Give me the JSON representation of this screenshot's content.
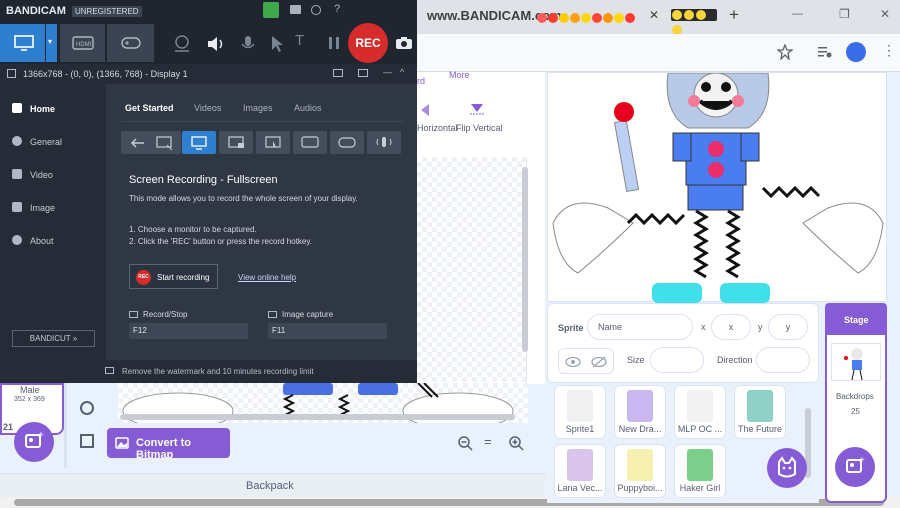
{
  "chrome": {
    "watermark": "www.BANDICAM.com",
    "tab_emojis": [
      "#ff5a5a",
      "#ff3b30",
      "#ffcc00",
      "#ff9f0a",
      "#ffd60a",
      "#ff453a",
      "#ff9500",
      "#ffd60a",
      "#ff3b30",
      "#ff6b3b"
    ],
    "close_label": "✕",
    "new_tab_label": "+",
    "minimize": "—",
    "restore": "❐",
    "close_window": "✕"
  },
  "scratch": {
    "more_label": "More",
    "flip_horizontal": "Horizontal",
    "flip_vertical": "Flip Vertical",
    "costume_name": "Male",
    "costume_size": "352 x 369",
    "costume_number": "21",
    "convert_button": "Convert to Bitmap",
    "backpack": "Backpack",
    "zoom_out": "−",
    "zoom_reset": "=",
    "zoom_in": "+",
    "sprite_label": "Sprite",
    "sprite_name_placeholder": "Name",
    "x_label": "x",
    "x_placeholder": "x",
    "y_label": "y",
    "y_placeholder": "y",
    "size_label": "Size",
    "direction_label": "Direction",
    "stage_label": "Stage",
    "backdrops_label": "Backdrops",
    "backdrops_count": "25",
    "sprites_row1": [
      "Sprite1",
      "New Dra...",
      "MLP OC ...",
      "The Future"
    ],
    "sprites_row2": [
      "Lana Vec...",
      "Puppyboi...",
      "Haker Girl"
    ]
  },
  "bandicam": {
    "logo": "BANDICAM",
    "license": "UNREGISTERED",
    "rec_label": "REC",
    "resolution": "1366x768 - (0, 0), (1366, 768) - Display 1",
    "nav": [
      "Home",
      "General",
      "Video",
      "Image",
      "About"
    ],
    "bandicut": "BANDICUT »",
    "tabs": [
      "Get Started",
      "Videos",
      "Images",
      "Audios"
    ],
    "mode_title": "Screen Recording - Fullscreen",
    "mode_desc": "This mode allows you to record the whole screen of your display.",
    "step1": "1. Choose a monitor to be captured.",
    "step2": "2. Click the 'REC' button or press the record hotkey.",
    "start_rec_icon": "REC",
    "start_recording": "Start recording",
    "online_help": "View online help",
    "record_stop_label": "Record/Stop",
    "record_stop_key": "F12",
    "image_capture_label": "Image capture",
    "image_capture_key": "F11",
    "footer": "Remove the watermark and 10 minutes recording limit"
  },
  "colors": {
    "scratch_purple": "#855cd6",
    "rec_red": "#d62b2b",
    "bandicam_bg": "#2b3340",
    "selected_blue": "#2f7fd1"
  }
}
